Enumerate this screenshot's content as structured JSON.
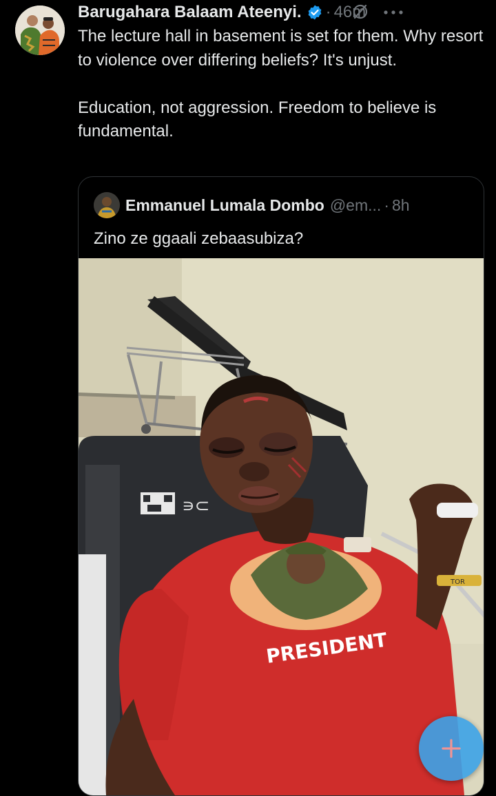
{
  "tweet": {
    "author_name": "Barugahara Balaam Ateenyi.",
    "separator": "·",
    "time": "46m",
    "icons": {
      "verified": "verified-badge-icon",
      "grok": "grok-icon",
      "more": "more-options-icon"
    },
    "paragraphs": [
      "The lecture hall in basement is set for them. Why resort to violence over differing beliefs? It's unjust.",
      "Education, not aggression. Freedom to believe is fundamental."
    ]
  },
  "quoted_tweet": {
    "author_name": "Emmanuel Lumala Dombo",
    "handle": "@em...",
    "separator": "·",
    "time": "8h",
    "text": "Zino ze ggaali zebaasubiza?",
    "image": {
      "shirt_text": "PRESIDENT",
      "wristband_text": "TOR"
    }
  },
  "fab": {
    "icon": "plus-icon",
    "color": "#3da3e8"
  },
  "colors": {
    "background": "#000000",
    "text": "#e7e9ea",
    "secondary": "#71767b",
    "border": "#2f3336",
    "accent": "#1d9bf0"
  }
}
